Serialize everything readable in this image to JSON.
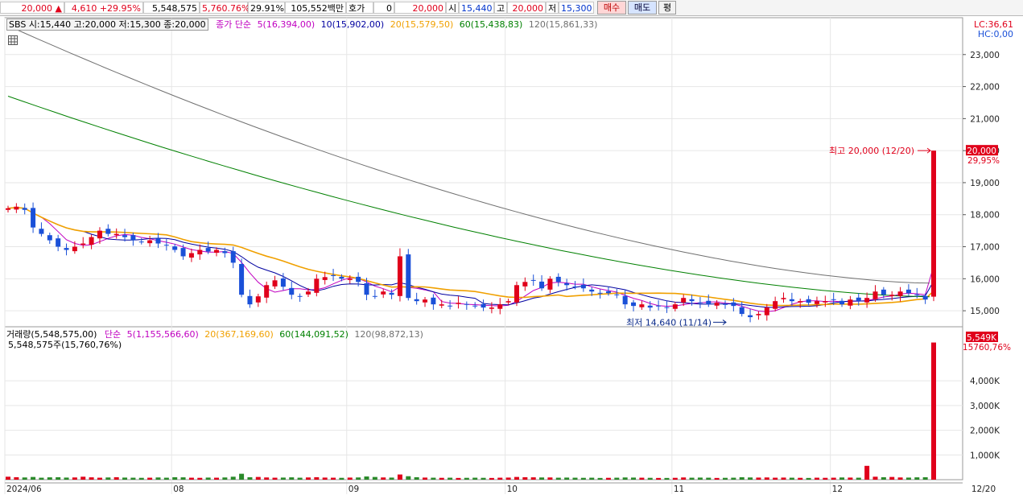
{
  "ticker": {
    "price": "20,000",
    "change": "4,610",
    "change_pct": "+29.95%",
    "volume": "5,548,575",
    "volume_ratio": "5,760.76%",
    "turnover": "29.91%",
    "amount": "105,552백만",
    "hoga_label": "호가",
    "hoga_value": "0",
    "quote_price": "20,000",
    "open_label": "시",
    "open": "15,440",
    "high_label": "고",
    "high": "20,000",
    "low_label": "저",
    "low": "15,300",
    "buy_label": "매수",
    "sell_label": "매도",
    "eval_label": "평"
  },
  "price_panel": {
    "info": "SBS 시:15,440 고:20,000 저:15,300 종:20,000",
    "ma_title": "종가 단순",
    "ma": [
      {
        "label": "5(16,394,00)",
        "color": "#c000c0"
      },
      {
        "label": "10(15,902,00)",
        "color": "#0000a0"
      },
      {
        "label": "20(15,579,50)",
        "color": "#f0a000"
      },
      {
        "label": "60(15,438,83)",
        "color": "#008000"
      },
      {
        "label": "120(15,861,33)",
        "color": "#707070"
      }
    ],
    "lc": "LC:36,61",
    "hc": "HC:0,00",
    "high_annot": "최고 20,000 (12/20)",
    "low_annot": "최저 14,640 (11/14)",
    "current_tag": "20,000",
    "current_pct": "29,95%"
  },
  "volume_panel": {
    "title": "거래량(5,548,575,00)",
    "ma_title": "단순",
    "ma": [
      {
        "label": "5(1,155,566,60)",
        "color": "#c000c0"
      },
      {
        "label": "20(367,169,60)",
        "color": "#f0a000"
      },
      {
        "label": "60(144,091,52)",
        "color": "#008000"
      },
      {
        "label": "120(98,872,13)",
        "color": "#707070"
      }
    ],
    "sub": "5,548,575주(15,760,76%)",
    "current_tag": "5,549K",
    "current_pct": "15760,76%"
  },
  "x_axis": {
    "labels": [
      "2024/06",
      "08",
      "09",
      "10",
      "11",
      "12"
    ],
    "end_label": "12/20"
  },
  "colors": {
    "up": "#e0001b",
    "down": "#1a50d8",
    "ma5": "#c000c0",
    "ma10": "#0000a0",
    "ma20": "#f0a000",
    "ma60": "#008000",
    "ma120": "#707070"
  },
  "chart_data": {
    "type": "candlestick",
    "price_axis": {
      "ticks": [
        "23,000",
        "22,000",
        "21,000",
        "20,000",
        "19,000",
        "18,000",
        "17,000",
        "16,000",
        "15,000"
      ],
      "range": [
        14500,
        24000
      ]
    },
    "volume_axis": {
      "ticks": [
        "4,000K",
        "3,000K",
        "2,000K",
        "1,000K"
      ],
      "range": [
        0,
        5600000
      ]
    },
    "closes": [
      18200,
      18250,
      18150,
      17600,
      17400,
      17200,
      17000,
      16900,
      17000,
      17100,
      17300,
      17500,
      17400,
      17400,
      17300,
      17200,
      17150,
      17200,
      17100,
      17050,
      16900,
      16700,
      16800,
      16900,
      16850,
      16900,
      16800,
      16500,
      15500,
      15200,
      15450,
      15800,
      15950,
      15750,
      15500,
      15450,
      15600,
      16000,
      16050,
      16100,
      16000,
      16000,
      15900,
      15500,
      15450,
      15600,
      15500,
      16700,
      15400,
      15300,
      15350,
      15200,
      15200,
      15150,
      15250,
      15200,
      15150,
      15100,
      15100,
      15200,
      15300,
      15800,
      15900,
      15950,
      15700,
      16000,
      15900,
      15800,
      15750,
      15700,
      15600,
      15550,
      15550,
      15500,
      15200,
      15150,
      15200,
      15100,
      15150,
      15100,
      15200,
      15400,
      15300,
      15250,
      15200,
      15250,
      15200,
      15150,
      14900,
      14800,
      14900,
      15100,
      15300,
      15400,
      15300,
      15300,
      15250,
      15300,
      15300,
      15350,
      15200,
      15350,
      15300,
      15400,
      15600,
      15500,
      15500,
      15600,
      15550,
      15500,
      15350,
      20000
    ],
    "volumes": [
      120,
      100,
      90,
      110,
      80,
      95,
      100,
      85,
      90,
      120,
      95,
      80,
      90,
      100,
      85,
      80,
      75,
      80,
      90,
      80,
      100,
      95,
      80,
      75,
      85,
      80,
      90,
      120,
      240,
      100,
      110,
      90,
      80,
      85,
      95,
      80,
      90,
      100,
      85,
      80,
      75,
      85,
      90,
      130,
      110,
      90,
      85,
      210,
      140,
      100,
      85,
      80,
      75,
      80,
      70,
      75,
      80,
      75,
      70,
      80,
      85,
      110,
      100,
      95,
      90,
      90,
      80,
      85,
      80,
      75,
      80,
      70,
      75,
      80,
      90,
      85,
      80,
      75,
      70,
      70,
      75,
      90,
      80,
      85,
      80,
      70,
      75,
      80,
      100,
      90,
      85,
      90,
      80,
      85,
      80,
      75,
      70,
      80,
      75,
      80,
      90,
      85,
      80,
      560,
      120,
      100,
      110,
      90,
      85,
      95,
      100,
      5549
    ]
  }
}
